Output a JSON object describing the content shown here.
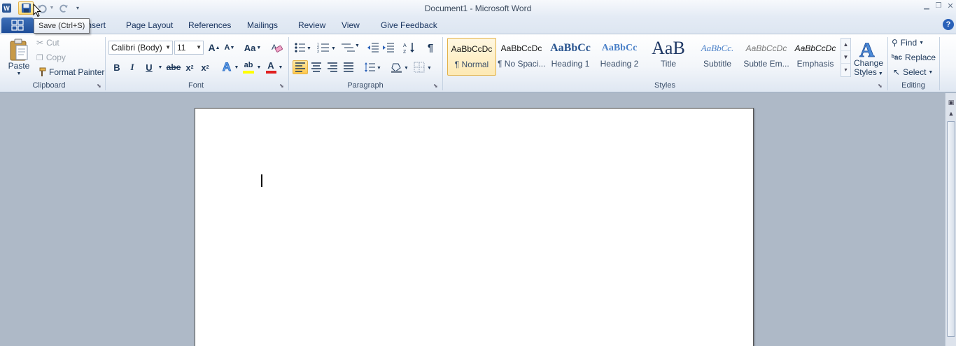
{
  "window": {
    "title": "Document1  -  Microsoft Word",
    "controls": [
      "minimize",
      "restore",
      "close"
    ]
  },
  "quick_access": {
    "items": [
      "word-icon",
      "save-icon",
      "undo-icon",
      "redo-icon",
      "customize-icon"
    ]
  },
  "tooltip": {
    "text": "Save (Ctrl+S)"
  },
  "tabs": {
    "file": "",
    "insert": "Insert",
    "page_layout": "Page Layout",
    "references": "References",
    "mailings": "Mailings",
    "review": "Review",
    "view": "View",
    "give_feedback": "Give Feedback",
    "help": "?"
  },
  "clipboard": {
    "label": "Clipboard",
    "paste": "Paste",
    "cut": "Cut",
    "copy": "Copy",
    "format_painter": "Format Painter"
  },
  "font": {
    "label": "Font",
    "family": "Calibri (Body)",
    "size": "11",
    "grow": "A",
    "shrink": "A",
    "change_case": "Aa",
    "bold": "B",
    "italic": "I",
    "underline": "U",
    "strikethrough": "abc",
    "subscript": "x",
    "superscript": "x",
    "highlight": "ab",
    "font_color": "A"
  },
  "paragraph": {
    "label": "Paragraph",
    "show_marks": "¶"
  },
  "styles": {
    "label": "Styles",
    "items": [
      {
        "sample": "AaBbCcDc",
        "name": "¶ Normal"
      },
      {
        "sample": "AaBbCcDc",
        "name": "¶ No Spaci..."
      },
      {
        "sample": "AaBbCc",
        "name": "Heading 1"
      },
      {
        "sample": "AaBbCc",
        "name": "Heading 2"
      },
      {
        "sample": "AaB",
        "name": "Title"
      },
      {
        "sample": "AaBbCc.",
        "name": "Subtitle"
      },
      {
        "sample": "AaBbCcDc",
        "name": "Subtle Em..."
      },
      {
        "sample": "AaBbCcDc",
        "name": "Emphasis"
      }
    ],
    "change_styles_line1": "Change",
    "change_styles_line2": "Styles"
  },
  "editing": {
    "label": "Editing",
    "find": "Find",
    "replace": "Replace",
    "select": "Select"
  },
  "colors": {
    "accent": "#1f4e99",
    "highlight": "#ffff00",
    "font_color": "#e02020"
  }
}
